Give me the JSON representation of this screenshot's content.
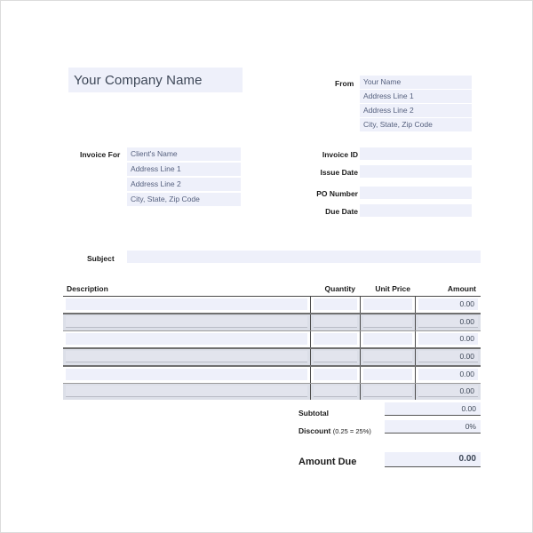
{
  "company": {
    "name": "Your Company Name"
  },
  "invoice_for": {
    "label": "Invoice For",
    "lines": [
      "Client's Name",
      "Address Line 1",
      "Address Line 2",
      "City, State, Zip Code"
    ]
  },
  "from": {
    "label": "From",
    "lines": [
      "Your Name",
      "Address Line 1",
      "Address Line 2",
      "City, State, Zip Code"
    ]
  },
  "meta": {
    "rows": [
      {
        "label": "Invoice ID",
        "value": ""
      },
      {
        "label": "Issue Date",
        "value": ""
      },
      {
        "label": "PO Number",
        "value": ""
      },
      {
        "label": "Due Date",
        "value": ""
      }
    ]
  },
  "subject": {
    "label": "Subject",
    "value": ""
  },
  "items": {
    "headers": {
      "description": "Description",
      "quantity": "Quantity",
      "unit_price": "Unit Price",
      "amount": "Amount"
    },
    "rows": [
      {
        "description": "",
        "quantity": "",
        "unit_price": "",
        "amount": "0.00"
      },
      {
        "description": "",
        "quantity": "",
        "unit_price": "",
        "amount": "0.00"
      },
      {
        "description": "",
        "quantity": "",
        "unit_price": "",
        "amount": "0.00"
      },
      {
        "description": "",
        "quantity": "",
        "unit_price": "",
        "amount": "0.00"
      },
      {
        "description": "",
        "quantity": "",
        "unit_price": "",
        "amount": "0.00"
      },
      {
        "description": "",
        "quantity": "",
        "unit_price": "",
        "amount": "0.00"
      }
    ]
  },
  "totals": {
    "subtotal_label": "Subtotal",
    "subtotal_value": "0.00",
    "discount_label": "Discount ",
    "discount_hint": "(0.25 = 25%)",
    "discount_value": "0%",
    "amount_due_label": "Amount Due",
    "amount_due_value": "0.00"
  },
  "colors": {
    "field_fill": "#eef0fa",
    "row_alt_fill": "#dcdfe8",
    "field_text": "#55607e",
    "label_text": "#1b1b1b",
    "rule": "#4a4a4a",
    "page_border": "#dcdcdc"
  }
}
